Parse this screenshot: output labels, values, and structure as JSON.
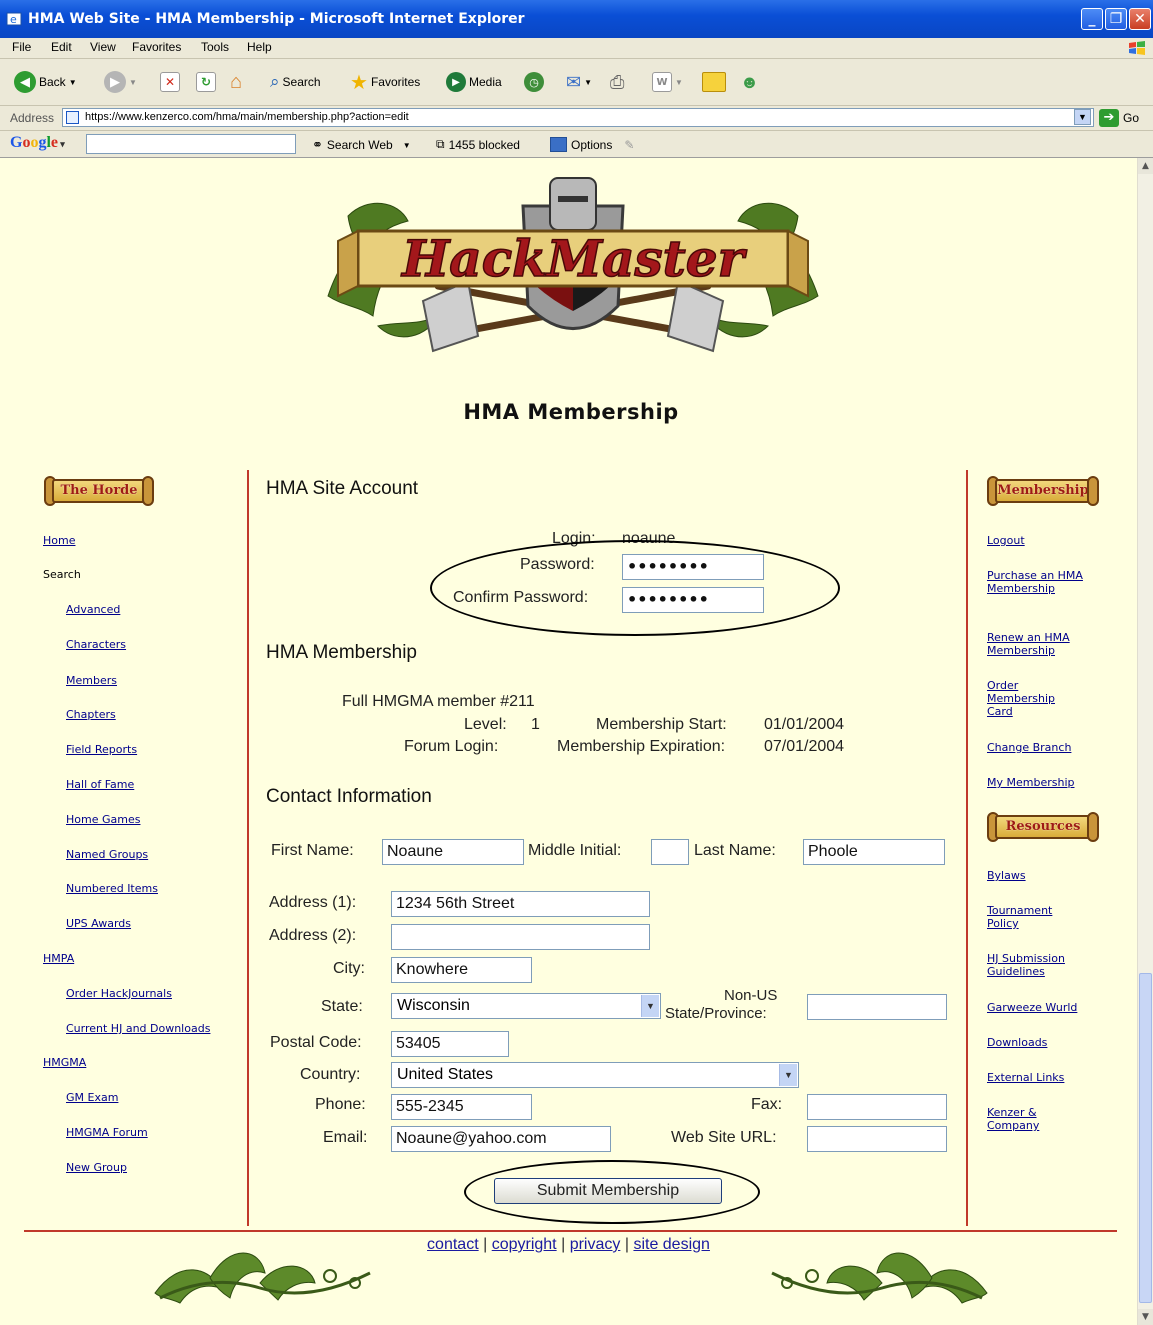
{
  "window": {
    "title": "HMA Web Site - HMA Membership - Microsoft Internet Explorer"
  },
  "menu": [
    "File",
    "Edit",
    "View",
    "Favorites",
    "Tools",
    "Help"
  ],
  "toolbar": {
    "back": "Back",
    "search": "Search",
    "favorites": "Favorites",
    "media": "Media"
  },
  "address": {
    "label": "Address",
    "url": "https://www.kenzerco.com/hma/main/membership.php?action=edit",
    "go": "Go"
  },
  "google_bar": {
    "search_web": "Search Web",
    "blocked": "1455 blocked",
    "options": "Options"
  },
  "page": {
    "logo_text": "HackMaster",
    "heading": "HMA Membership"
  },
  "left_nav": {
    "banner": "The Horde",
    "items": [
      {
        "label": "Home",
        "link": true
      },
      {
        "label": "Search",
        "link": false
      },
      {
        "label": "Advanced",
        "link": true
      },
      {
        "label": "Characters",
        "link": true
      },
      {
        "label": "Members",
        "link": true
      },
      {
        "label": "Chapters",
        "link": true
      },
      {
        "label": "Field Reports",
        "link": true
      },
      {
        "label": "Hall of Fame",
        "link": true
      },
      {
        "label": "Home Games",
        "link": true
      },
      {
        "label": "Named Groups",
        "link": true
      },
      {
        "label": "Numbered Items",
        "link": true
      },
      {
        "label": "UPS Awards",
        "link": true
      },
      {
        "label": "HMPA",
        "link": true
      },
      {
        "label": "Order HackJournals",
        "link": true
      },
      {
        "label": "Current HJ and Downloads",
        "link": true
      },
      {
        "label": "HMGMA",
        "link": true
      },
      {
        "label": "GM Exam",
        "link": true
      },
      {
        "label": "HMGMA Forum",
        "link": true
      },
      {
        "label": "New Group",
        "link": true
      }
    ]
  },
  "right_nav": {
    "membership_banner": "Membership",
    "membership_items": [
      "Logout",
      "Purchase an HMA Membership",
      "Renew an HMA Membership",
      "Order Membership Card",
      "Change Branch",
      "My Membership"
    ],
    "resources_banner": "Resources",
    "resources_items": [
      "Bylaws",
      "Tournament Policy",
      "HJ Submission Guidelines",
      "Garweeze Wurld",
      "Downloads",
      "External Links",
      "Kenzer & Company"
    ]
  },
  "account": {
    "title": "HMA Site Account",
    "login_label": "Login:",
    "login_value": "noaune",
    "password_label": "Password:",
    "password_value": "••••••••",
    "confirm_label": "Confirm Password:",
    "confirm_value": "••••••••"
  },
  "membership": {
    "title": "HMA Membership",
    "member_line": "Full HMGMA member #211",
    "level_label": "Level:",
    "level_value": "1",
    "start_label": "Membership Start:",
    "start_value": "01/01/2004",
    "forum_label": "Forum Login:",
    "expiration_label": "Membership Expiration:",
    "expiration_value": "07/01/2004"
  },
  "contact": {
    "title": "Contact Information",
    "first_name_label": "First Name:",
    "first_name": "Noaune",
    "middle_label": "Middle Initial:",
    "middle": "",
    "last_name_label": "Last Name:",
    "last_name": "Phoole",
    "address1_label": "Address (1):",
    "address1": "1234 56th Street",
    "address2_label": "Address (2):",
    "address2": "",
    "city_label": "City:",
    "city": "Knowhere",
    "state_label": "State:",
    "state": "Wisconsin",
    "nonus_label_1": "Non-US",
    "nonus_label_2": "State/Province:",
    "nonus": "",
    "postal_label": "Postal Code:",
    "postal": "53405",
    "country_label": "Country:",
    "country": "United States",
    "phone_label": "Phone:",
    "phone": "555-2345",
    "fax_label": "Fax:",
    "fax": "",
    "email_label": "Email:",
    "email": "Noaune@yahoo.com",
    "web_label": "Web Site URL:",
    "web": "",
    "submit": "Submit Membership"
  },
  "footer": {
    "links": [
      "contact",
      "copyright",
      "privacy",
      "site design"
    ],
    "separator": "|"
  }
}
